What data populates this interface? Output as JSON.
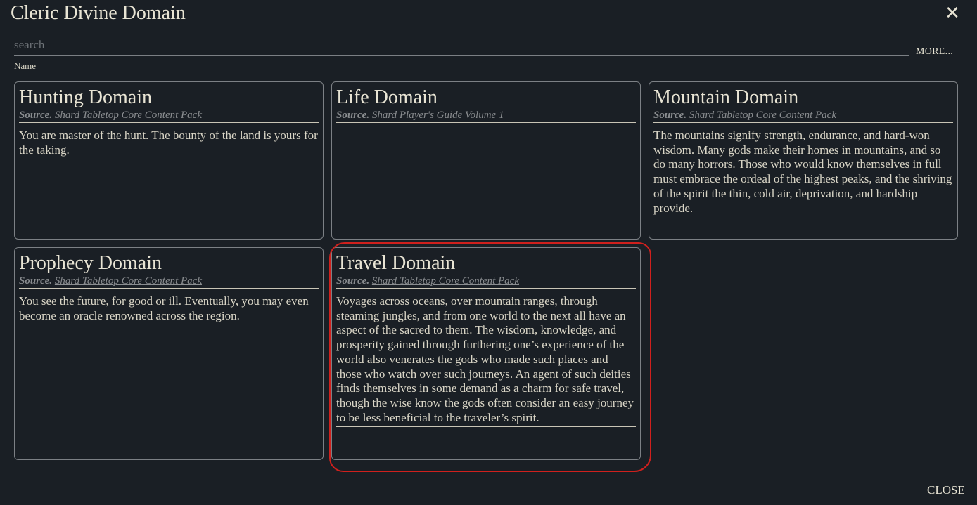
{
  "modal": {
    "title": "Cleric Divine Domain",
    "close_icon": "close-x-icon",
    "search_placeholder": "search",
    "search_value": "",
    "more_label": "MORE...",
    "sort_label": "Name",
    "close_label": "CLOSE"
  },
  "source_prefix": "Source.",
  "cards": [
    {
      "title": "Hunting Domain",
      "source": "Shard Tabletop Core Content Pack",
      "description": "You are master of the hunt. The bounty of the land is yours for the taking."
    },
    {
      "title": "Life Domain",
      "source": "Shard Player's Guide Volume 1",
      "description": ""
    },
    {
      "title": "Mountain Domain",
      "source": "Shard Tabletop Core Content Pack",
      "description": "The mountains signify strength, endurance, and hard-won wisdom. Many gods make their homes in mountains, and so do many horrors. Those who would know themselves in full must embrace the ordeal of the highest peaks, and the shriving of the spirit the thin, cold air, deprivation, and hardship provide."
    },
    {
      "title": "Prophecy Domain",
      "source": "Shard Tabletop Core Content Pack",
      "description": "You see the future, for good or ill. Eventually, you may even become an oracle renowned across the region."
    },
    {
      "title": "Travel Domain",
      "source": "Shard Tabletop Core Content Pack",
      "description": "Voyages across oceans, over mountain ranges, through steaming jungles, and from one world to the next all have an aspect of the sacred to them. The wisdom, knowledge, and prosperity gained through furthering one’s experience of the world also venerates the gods who made such places and those who watch over such journeys. An agent of such deities finds themselves in some demand as a charm for safe travel, though the wise know the gods often consider an easy journey to be less beneficial to the traveler’s spirit."
    }
  ],
  "colors": {
    "background": "#1a1f25",
    "text": "#e8e4d4",
    "border": "#7c8085",
    "source_text": "#8a8d90",
    "highlight": "#d0201d"
  }
}
